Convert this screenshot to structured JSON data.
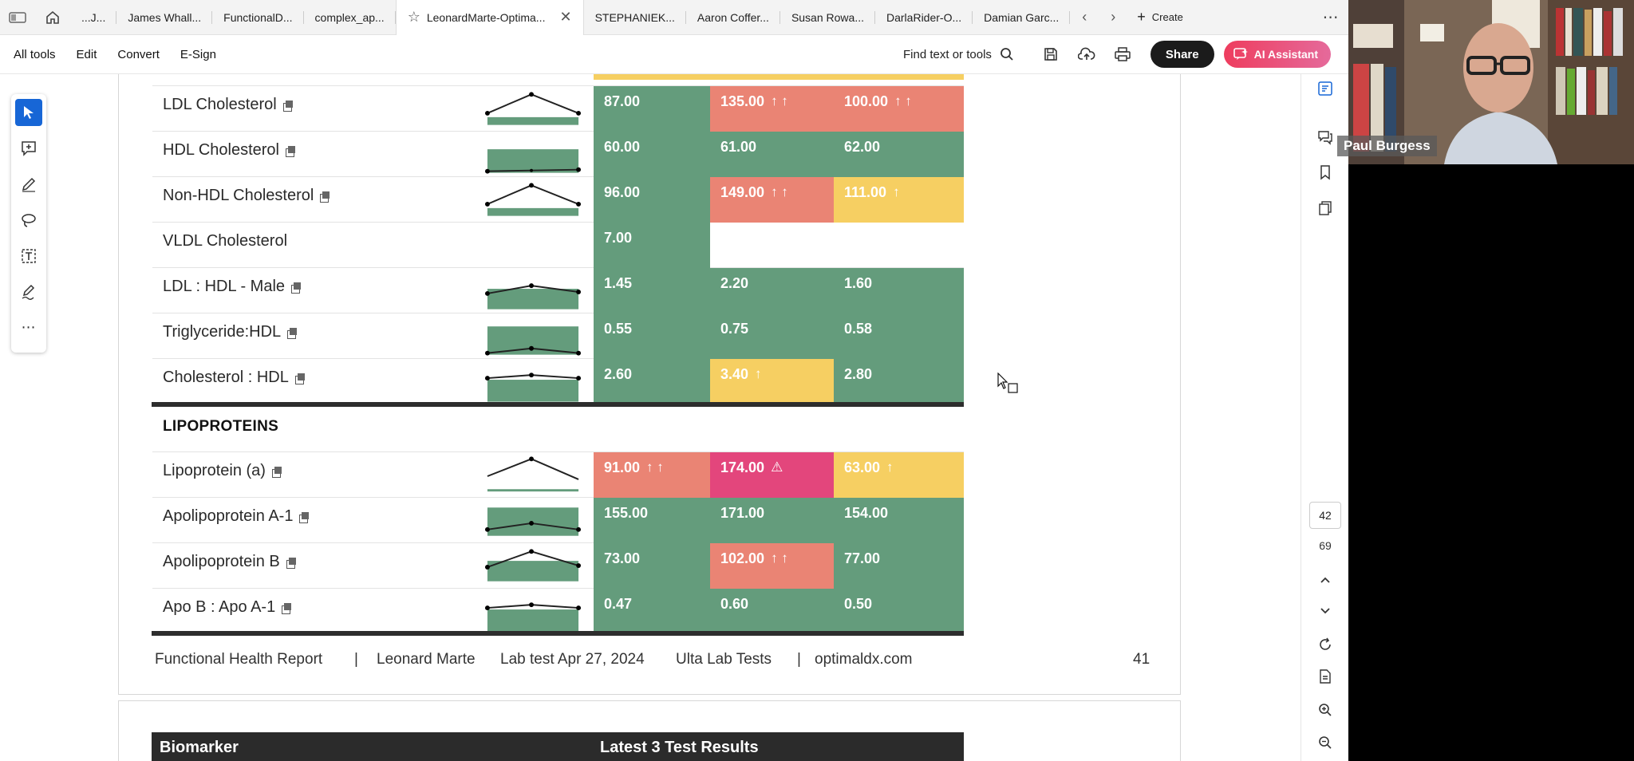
{
  "tabs": {
    "items": [
      {
        "label": "...J..."
      },
      {
        "label": "James Whall..."
      },
      {
        "label": "FunctionalD..."
      },
      {
        "label": "complex_ap..."
      },
      {
        "label": "LeonardMarte-Optima...",
        "active": true
      },
      {
        "label": "STEPHANIEK..."
      },
      {
        "label": "Aaron Coffer..."
      },
      {
        "label": "Susan Rowa..."
      },
      {
        "label": "DarlaRider-O..."
      },
      {
        "label": "Damian Garc..."
      }
    ],
    "create_label": "Create"
  },
  "toolbar": {
    "menus": [
      "All tools",
      "Edit",
      "Convert",
      "E-Sign"
    ],
    "find_label": "Find text or tools",
    "share_label": "Share",
    "ai_label": "AI Assistant"
  },
  "report": {
    "rows": [
      {
        "name": "LDL Cholesterol",
        "v1": "87.00",
        "v2": "135.00",
        "v2_mark": "↑ ↑",
        "v3": "100.00",
        "v3_mark": "↑ ↑",
        "colors": [
          "green",
          "red",
          "red"
        ]
      },
      {
        "name": "HDL Cholesterol",
        "v1": "60.00",
        "v2": "61.00",
        "v3": "62.00",
        "colors": [
          "green",
          "green",
          "green"
        ]
      },
      {
        "name": "Non-HDL Cholesterol",
        "v1": "96.00",
        "v2": "149.00",
        "v2_mark": "↑ ↑",
        "v3": "111.00",
        "v3_mark": "↑",
        "colors": [
          "green",
          "red",
          "yellow"
        ]
      },
      {
        "name": "VLDL Cholesterol",
        "v1": "7.00",
        "colors": [
          "green"
        ]
      },
      {
        "name": "LDL : HDL - Male",
        "v1": "1.45",
        "v2": "2.20",
        "v3": "1.60",
        "colors": [
          "green",
          "green",
          "green"
        ]
      },
      {
        "name": "Triglyceride:HDL",
        "v1": "0.55",
        "v2": "0.75",
        "v3": "0.58",
        "colors": [
          "green",
          "green",
          "green"
        ]
      },
      {
        "name": "Cholesterol : HDL",
        "v1": "2.60",
        "v2": "3.40",
        "v2_mark": "↑",
        "v3": "2.80",
        "colors": [
          "green",
          "yellow",
          "green"
        ]
      }
    ],
    "section_title": "LIPOPROTEINS",
    "lipo_rows": [
      {
        "name": "Lipoprotein (a)",
        "v1": "91.00",
        "v1_mark": "↑ ↑",
        "v2": "174.00",
        "v2_mark": "⚠",
        "v3": "63.00",
        "v3_mark": "↑",
        "colors": [
          "red",
          "pink",
          "yellow"
        ]
      },
      {
        "name": "Apolipoprotein A-1",
        "v1": "155.00",
        "v2": "171.00",
        "v3": "154.00",
        "colors": [
          "green",
          "green",
          "green"
        ]
      },
      {
        "name": "Apolipoprotein B",
        "v1": "73.00",
        "v2": "102.00",
        "v2_mark": "↑ ↑",
        "v3": "77.00",
        "colors": [
          "green",
          "red",
          "green"
        ]
      },
      {
        "name": "Apo B : Apo A-1",
        "v1": "0.47",
        "v2": "0.60",
        "v3": "0.50",
        "colors": [
          "green",
          "green",
          "green"
        ]
      }
    ],
    "footer": {
      "title": "Functional Health Report",
      "sep": "|",
      "patient": "Leonard Marte",
      "labtest": "Lab test Apr 27, 2024",
      "lab": "Ulta Lab Tests",
      "site": "optimaldx.com",
      "page": "41"
    },
    "next_header": {
      "col1": "Biomarker",
      "col2": "Latest 3 Test Results"
    }
  },
  "pager": {
    "current": "42",
    "total": "69"
  },
  "webcam": {
    "name": "Paul Burgess"
  },
  "colors": {
    "green": "#649c7c",
    "red": "#ea8474",
    "yellow": "#f6cf62",
    "pink": "#e3467c",
    "accent": "#1766d6"
  }
}
